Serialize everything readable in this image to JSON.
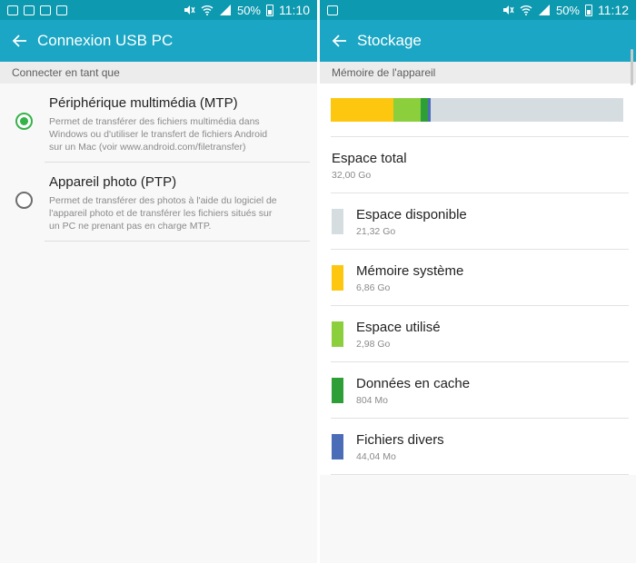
{
  "left": {
    "status": {
      "battery": "50%",
      "time": "11:10",
      "notifications": [
        "image-icon",
        "image-icon",
        "image-icon",
        "image-icon"
      ]
    },
    "appbar": {
      "title": "Connexion USB PC"
    },
    "section": {
      "label": "Connecter en tant que"
    },
    "options": [
      {
        "title": "Périphérique multimédia (MTP)",
        "lines": [
          "Permet de transférer des fichiers multimédia dans",
          "Windows ou d'utiliser le transfert de fichiers Android",
          "sur un Mac (voir www.android.com/filetransfer)"
        ],
        "selected": true
      },
      {
        "title": "Appareil photo (PTP)",
        "lines": [
          "Permet de transférer des photos à l'aide du logiciel de",
          "l'appareil photo et de transférer les fichiers situés sur",
          "un PC ne prenant pas en charge MTP."
        ],
        "selected": false
      }
    ]
  },
  "right": {
    "status": {
      "battery": "50%",
      "time": "11:12",
      "notifications": [
        "image-icon"
      ]
    },
    "appbar": {
      "title": "Stockage"
    },
    "section": {
      "label": "Mémoire de l'appareil"
    },
    "total": {
      "label": "Espace total",
      "value": "32,00 Go"
    },
    "items": [
      {
        "label": "Espace disponible",
        "value": "21,32 Go",
        "color": "#d6dde0",
        "fraction": 0.666
      },
      {
        "label": "Mémoire système",
        "value": "6,86 Go",
        "color": "#fdc70f",
        "fraction": 0.214
      },
      {
        "label": "Espace utilisé",
        "value": "2,98 Go",
        "color": "#8bcf3d",
        "fraction": 0.093
      },
      {
        "label": "Données en cache",
        "value": "804 Mo",
        "color": "#2e9f36",
        "fraction": 0.025
      },
      {
        "label": "Fichiers divers",
        "value": "44,04 Mo",
        "color": "#4b6cb7",
        "fraction": 0.0014
      }
    ]
  }
}
